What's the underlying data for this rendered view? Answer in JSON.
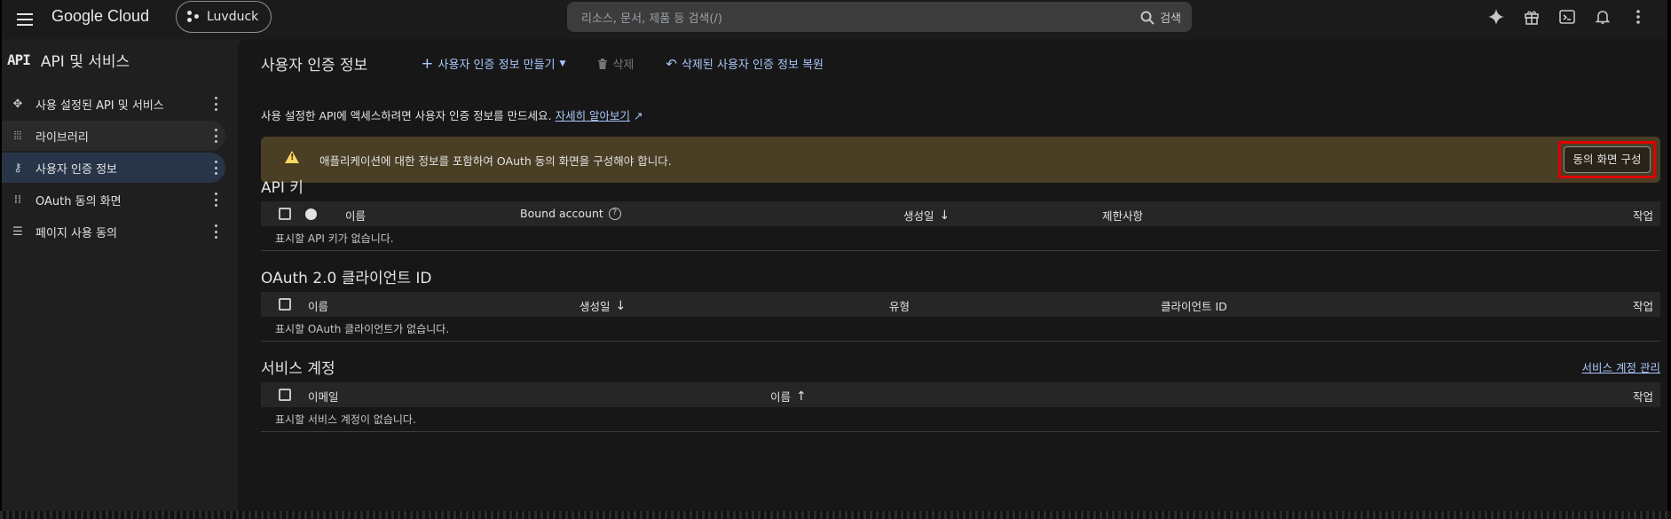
{
  "topbar": {
    "logo": "Google Cloud",
    "project": "Luvduck",
    "search_placeholder": "리소스, 문서, 제품 등 검색(/)",
    "search_button": "검색"
  },
  "sidebar": {
    "badge": "API",
    "title": "API 및 서비스",
    "items": [
      {
        "label": "사용 설정된 API 및 서비스",
        "icon": "api-hub-icon"
      },
      {
        "label": "라이브러리",
        "icon": "library-icon"
      },
      {
        "label": "사용자 인증 정보",
        "icon": "key-icon"
      },
      {
        "label": "OAuth 동의 화면",
        "icon": "oauth-icon"
      },
      {
        "label": "페이지 사용 동의",
        "icon": "settings-list-icon"
      }
    ]
  },
  "main": {
    "title": "사용자 인증 정보",
    "toolbar": {
      "create": "사용자 인증 정보 만들기",
      "delete": "삭제",
      "restore": "삭제된 사용자 인증 정보 복원"
    },
    "info_text": "사용 설정한 API에 액세스하려면 사용자 인증 정보를 만드세요.",
    "info_link": "자세히 알아보기",
    "banner": {
      "message": "애플리케이션에 대한 정보를 포함하여 OAuth 동의 화면을 구성해야 합니다.",
      "button": "동의 화면 구성"
    },
    "api_keys": {
      "title": "API 키",
      "columns": [
        "이름",
        "Bound account",
        "생성일",
        "제한사항",
        "작업"
      ],
      "empty": "표시할 API 키가 없습니다."
    },
    "oauth": {
      "title": "OAuth 2.0 클라이언트 ID",
      "columns": [
        "이름",
        "생성일",
        "유형",
        "클라이언트 ID",
        "작업"
      ],
      "empty": "표시할 OAuth 클라이언트가 없습니다."
    },
    "service_accounts": {
      "title": "서비스 계정",
      "manage_link": "서비스 계정 관리",
      "columns": [
        "이메일",
        "이름",
        "작업"
      ],
      "empty": "표시할 서비스 계정이 없습니다."
    }
  }
}
